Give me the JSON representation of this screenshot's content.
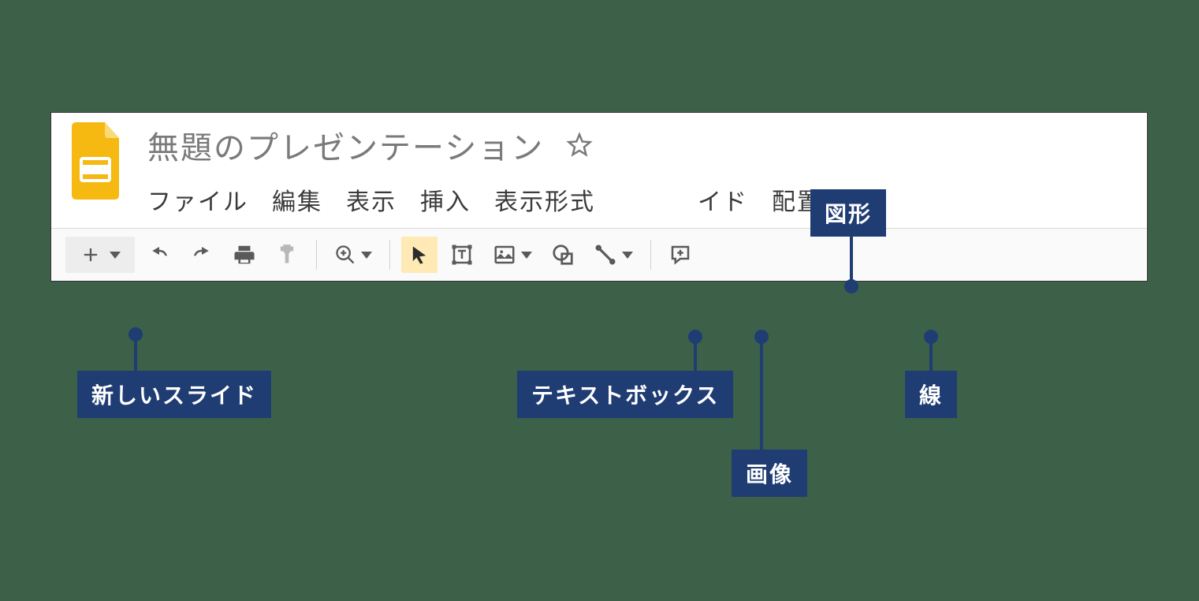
{
  "document": {
    "title": "無題のプレゼンテーション"
  },
  "menu": {
    "file": "ファイル",
    "edit": "編集",
    "view": "表示",
    "insert": "挿入",
    "format": "表示形式",
    "slide_partial": "イド",
    "arrange": "配置"
  },
  "callouts": {
    "new_slide": "新しいスライド",
    "text_box": "テキストボックス",
    "image": "画像",
    "shape": "図形",
    "line": "線"
  }
}
